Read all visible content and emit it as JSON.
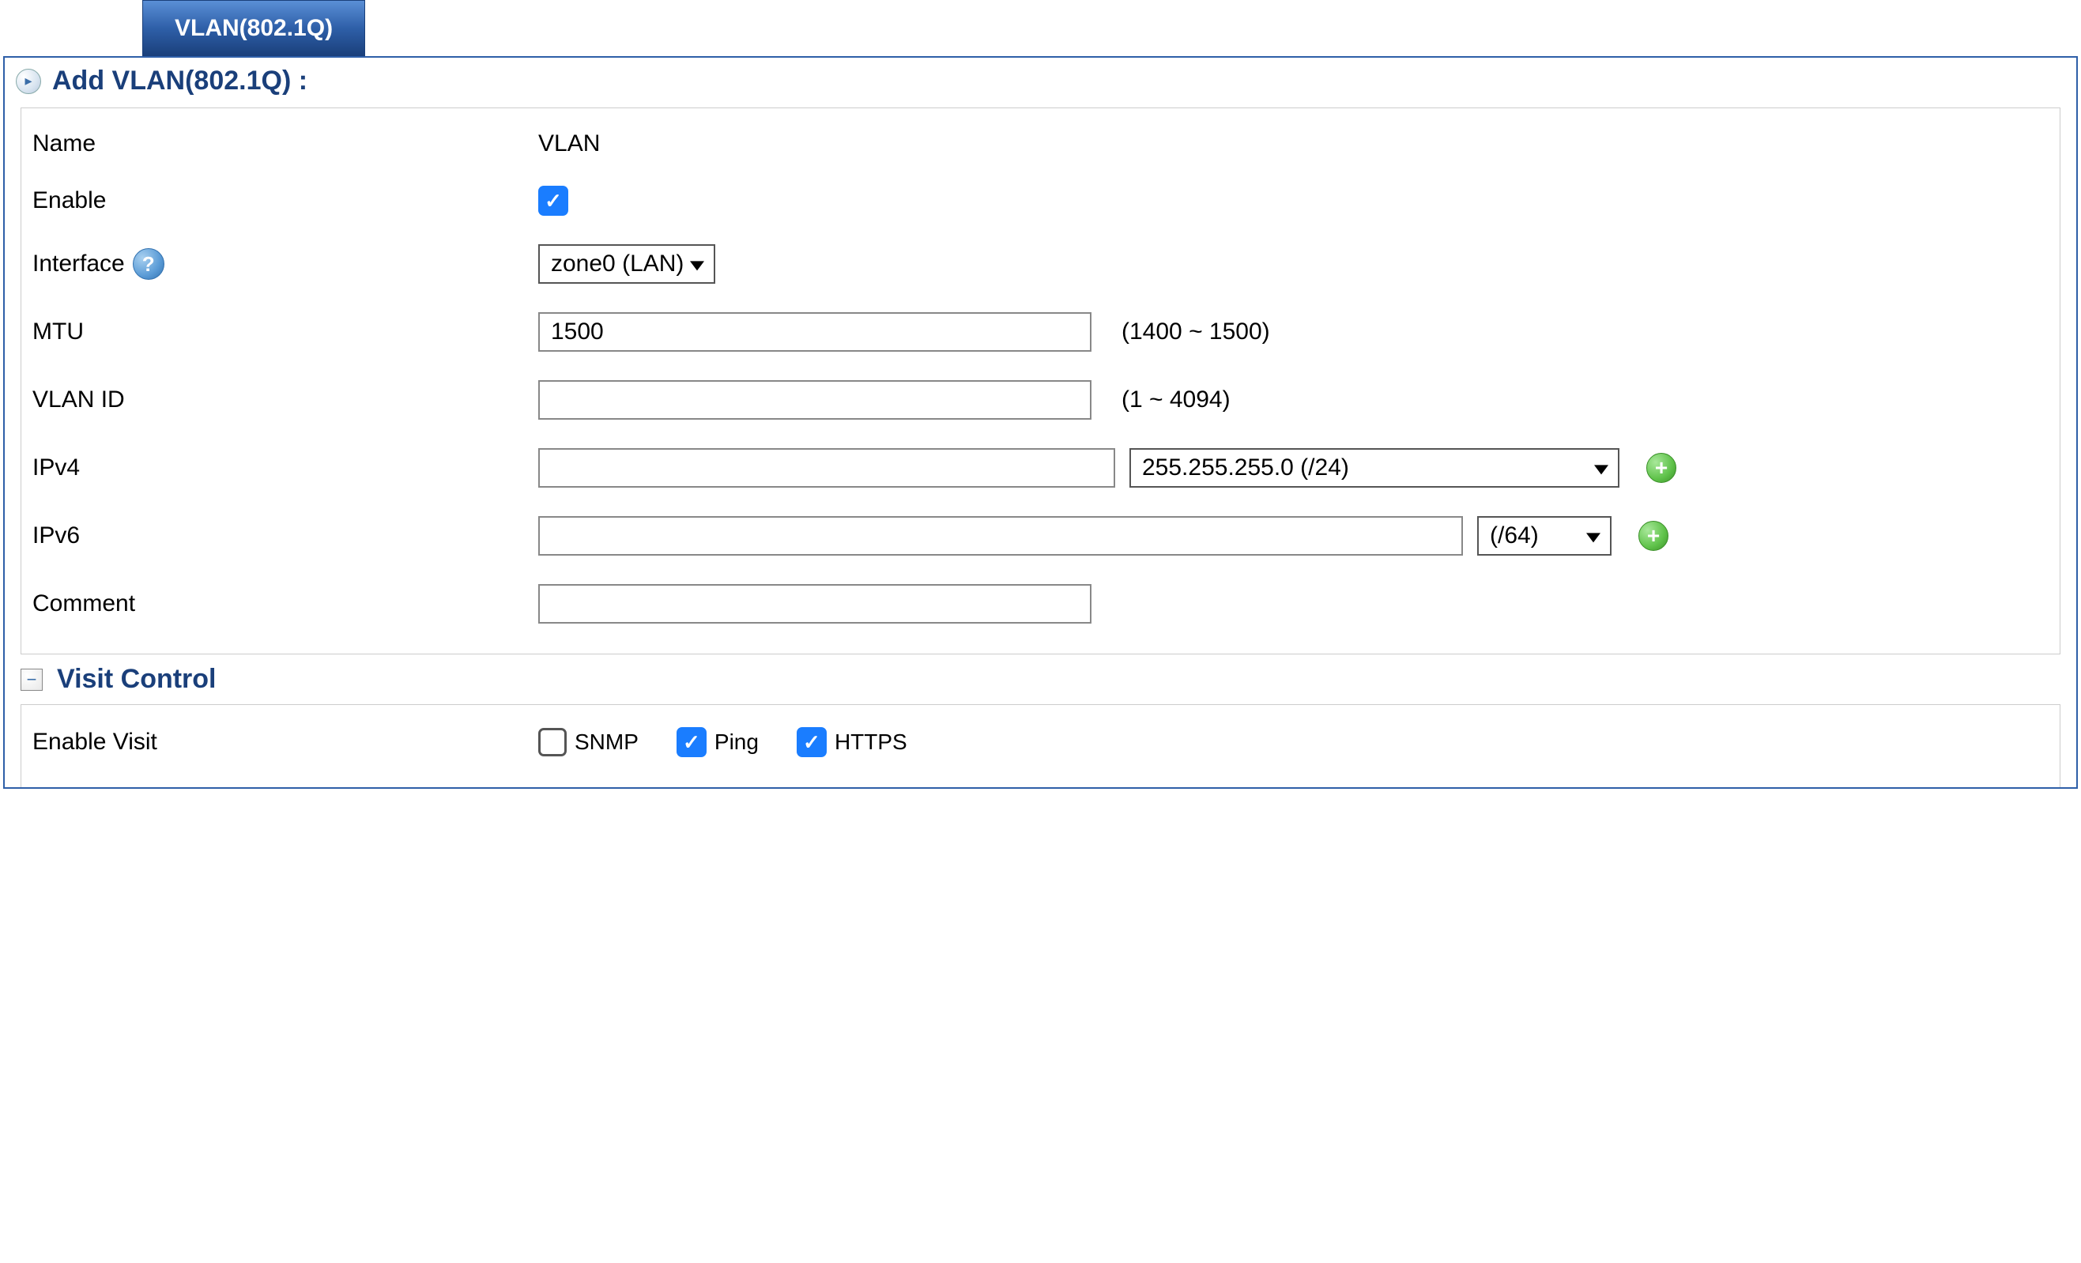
{
  "tab": {
    "label": "VLAN(802.1Q)"
  },
  "section": {
    "title": "Add VLAN(802.1Q) :"
  },
  "form": {
    "name_label": "Name",
    "name_value": "VLAN",
    "enable_label": "Enable",
    "enable_checked": true,
    "interface_label": "Interface",
    "interface_value": "zone0 (LAN)",
    "mtu_label": "MTU",
    "mtu_value": "1500",
    "mtu_hint": "(1400 ~ 1500)",
    "vlanid_label": "VLAN ID",
    "vlanid_value": "",
    "vlanid_hint": "(1 ~ 4094)",
    "ipv4_label": "IPv4",
    "ipv4_value": "",
    "ipv4_mask": "255.255.255.0 (/24)",
    "ipv6_label": "IPv6",
    "ipv6_value": "",
    "ipv6_prefix": "(/64)",
    "comment_label": "Comment",
    "comment_value": ""
  },
  "visit": {
    "title": "Visit Control",
    "enable_label": "Enable Visit",
    "options": {
      "snmp_label": "SNMP",
      "snmp_checked": false,
      "ping_label": "Ping",
      "ping_checked": true,
      "https_label": "HTTPS",
      "https_checked": true
    }
  }
}
